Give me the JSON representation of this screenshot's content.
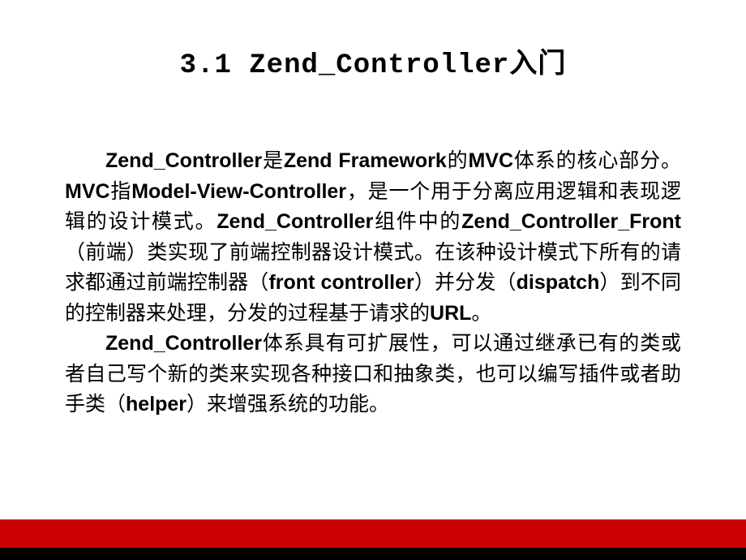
{
  "title": "3.1  Zend_Controller入门",
  "paragraphs": [
    {
      "segments": [
        {
          "text": "Zend_Controller",
          "bold": true
        },
        {
          "text": "是",
          "bold": false
        },
        {
          "text": "Zend Framework",
          "bold": true
        },
        {
          "text": "的",
          "bold": false
        },
        {
          "text": "MVC",
          "bold": true
        },
        {
          "text": "体系的核心部分。",
          "bold": false
        },
        {
          "text": "MVC",
          "bold": true
        },
        {
          "text": "指",
          "bold": false
        },
        {
          "text": "Model-View-Controller",
          "bold": true
        },
        {
          "text": "，是一个用于分离应用逻辑和表现逻辑的设计模式。",
          "bold": false
        },
        {
          "text": "Zend_Controller",
          "bold": true
        },
        {
          "text": "组件中的",
          "bold": false
        },
        {
          "text": "Zend_Controller_Front",
          "bold": true
        },
        {
          "text": "（前端）类实现了前端控制器设计模式。在该种设计模式下所有的请求都通过前端控制器（",
          "bold": false
        },
        {
          "text": "front controller",
          "bold": true
        },
        {
          "text": "）并分发（",
          "bold": false
        },
        {
          "text": "dispatch",
          "bold": true
        },
        {
          "text": "）到不同的控制器来处理，分发的过程基于请求的",
          "bold": false
        },
        {
          "text": "URL",
          "bold": true
        },
        {
          "text": "。",
          "bold": false
        }
      ]
    },
    {
      "segments": [
        {
          "text": "Zend_Controller",
          "bold": true
        },
        {
          "text": "体系具有可扩展性，可以通过继承已有的类或者自己写个新的类来实现各种接口和抽象类，也可以编写插件或者助手类（",
          "bold": false
        },
        {
          "text": "helper",
          "bold": true
        },
        {
          "text": "）来增强系统的功能。",
          "bold": false
        }
      ]
    }
  ]
}
